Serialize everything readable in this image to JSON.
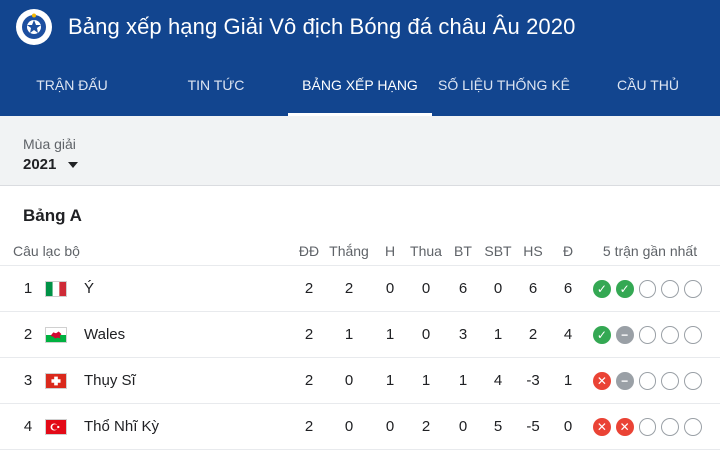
{
  "app": {
    "title": "Bảng xếp hạng Giải Vô địch Bóng đá châu Âu 2020"
  },
  "tabs": [
    {
      "label": "TRẬN ĐẤU",
      "active": false
    },
    {
      "label": "TIN TỨC",
      "active": false
    },
    {
      "label": "BẢNG XẾP HẠNG",
      "active": true
    },
    {
      "label": "SỐ LIỆU THỐNG KÊ",
      "active": false
    },
    {
      "label": "CẦU THỦ",
      "active": false
    }
  ],
  "season": {
    "label": "Mùa giải",
    "value": "2021"
  },
  "group": {
    "title": "Bảng A"
  },
  "table": {
    "headers": {
      "club": "Câu lạc bộ",
      "played": "ĐĐ",
      "won": "Thắng",
      "drawn": "H",
      "lost": "Thua",
      "gf": "BT",
      "ga": "SBT",
      "gd": "HS",
      "pts": "Đ",
      "form": "5 trận gần nhất"
    },
    "rows": [
      {
        "pos": "1",
        "flag": "italy",
        "name": "Ý",
        "played": "2",
        "won": "2",
        "drawn": "0",
        "lost": "0",
        "gf": "6",
        "ga": "0",
        "gd": "6",
        "pts": "6",
        "form": [
          "W",
          "W",
          "",
          "",
          ""
        ]
      },
      {
        "pos": "2",
        "flag": "wales",
        "name": "Wales",
        "played": "2",
        "won": "1",
        "drawn": "1",
        "lost": "0",
        "gf": "3",
        "ga": "1",
        "gd": "2",
        "pts": "4",
        "form": [
          "W",
          "D",
          "",
          "",
          ""
        ]
      },
      {
        "pos": "3",
        "flag": "switzerland",
        "name": "Thụy Sĩ",
        "played": "2",
        "won": "0",
        "drawn": "1",
        "lost": "1",
        "gf": "1",
        "ga": "4",
        "gd": "-3",
        "pts": "1",
        "form": [
          "L",
          "D",
          "",
          "",
          ""
        ]
      },
      {
        "pos": "4",
        "flag": "turkey",
        "name": "Thổ Nhĩ Kỳ",
        "played": "2",
        "won": "0",
        "drawn": "0",
        "lost": "2",
        "gf": "0",
        "ga": "5",
        "gd": "-5",
        "pts": "0",
        "form": [
          "L",
          "L",
          "",
          "",
          ""
        ]
      }
    ]
  },
  "colors": {
    "header_bg": "#12458f",
    "win": "#34a853",
    "draw": "#9aa0a6",
    "loss": "#ea4335"
  }
}
